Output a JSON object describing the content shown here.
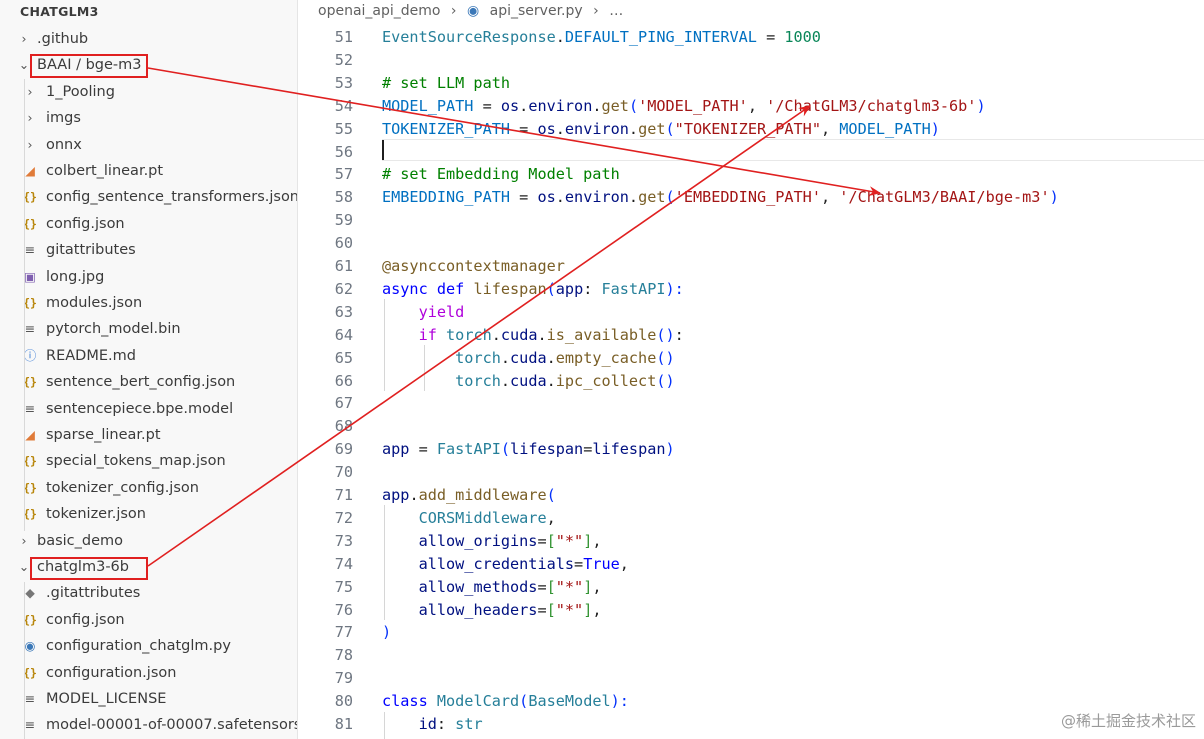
{
  "sidebar": {
    "title": "CHATGLM3",
    "items": [
      {
        "label": ".github",
        "icon": "chevron-right-icon",
        "glyph": "›",
        "cls": "chev",
        "name": "folder-github"
      },
      {
        "label": "BAAI / bge-m3",
        "icon": "chevron-down-icon",
        "glyph": "⌄",
        "cls": "chev",
        "name": "folder-baai-bge-m3"
      },
      {
        "label": "1_Pooling",
        "icon": "chevron-right-icon",
        "glyph": "›",
        "cls": "chev",
        "name": "folder-1-pooling"
      },
      {
        "label": "imgs",
        "icon": "chevron-right-icon",
        "glyph": "›",
        "cls": "chev",
        "name": "folder-imgs"
      },
      {
        "label": "onnx",
        "icon": "chevron-right-icon",
        "glyph": "›",
        "cls": "chev",
        "name": "folder-onnx"
      },
      {
        "label": "colbert_linear.pt",
        "icon": "rss-file-icon",
        "glyph": "◢",
        "cls": "ic-rss",
        "name": "file-colbert-linear"
      },
      {
        "label": "config_sentence_transformers.json",
        "icon": "json-file-icon",
        "glyph": "{}",
        "cls": "ic-json",
        "name": "file-config-sentence-transformers"
      },
      {
        "label": "config.json",
        "icon": "json-file-icon",
        "glyph": "{}",
        "cls": "ic-json",
        "name": "file-config-json"
      },
      {
        "label": "gitattributes",
        "icon": "lines-file-icon",
        "glyph": "≡",
        "cls": "ic-lines",
        "name": "file-gitattributes"
      },
      {
        "label": "long.jpg",
        "icon": "image-file-icon",
        "glyph": "▣",
        "cls": "ic-img",
        "name": "file-long-jpg"
      },
      {
        "label": "modules.json",
        "icon": "json-file-icon",
        "glyph": "{}",
        "cls": "ic-json",
        "name": "file-modules-json"
      },
      {
        "label": "pytorch_model.bin",
        "icon": "lines-file-icon",
        "glyph": "≡",
        "cls": "ic-lines",
        "name": "file-pytorch-model-bin"
      },
      {
        "label": "README.md",
        "icon": "info-file-icon",
        "glyph": "ⓘ",
        "cls": "ic-info",
        "name": "file-readme"
      },
      {
        "label": "sentence_bert_config.json",
        "icon": "json-file-icon",
        "glyph": "{}",
        "cls": "ic-json",
        "name": "file-sentence-bert-config"
      },
      {
        "label": "sentencepiece.bpe.model",
        "icon": "lines-file-icon",
        "glyph": "≡",
        "cls": "ic-lines",
        "name": "file-sentencepiece-model"
      },
      {
        "label": "sparse_linear.pt",
        "icon": "rss-file-icon",
        "glyph": "◢",
        "cls": "ic-rss",
        "name": "file-sparse-linear"
      },
      {
        "label": "special_tokens_map.json",
        "icon": "json-file-icon",
        "glyph": "{}",
        "cls": "ic-json",
        "name": "file-special-tokens-map"
      },
      {
        "label": "tokenizer_config.json",
        "icon": "json-file-icon",
        "glyph": "{}",
        "cls": "ic-json",
        "name": "file-tokenizer-config"
      },
      {
        "label": "tokenizer.json",
        "icon": "json-file-icon",
        "glyph": "{}",
        "cls": "ic-json",
        "name": "file-tokenizer-json"
      },
      {
        "label": "basic_demo",
        "icon": "chevron-right-icon",
        "glyph": "›",
        "cls": "chev",
        "name": "folder-basic-demo"
      },
      {
        "label": "chatglm3-6b",
        "icon": "chevron-down-icon",
        "glyph": "⌄",
        "cls": "chev",
        "name": "folder-chatglm3-6b"
      },
      {
        "label": ".gitattributes",
        "icon": "git-file-icon",
        "glyph": "◆",
        "cls": "ic-git",
        "name": "file-dot-gitattributes"
      },
      {
        "label": "config.json",
        "icon": "json-file-icon",
        "glyph": "{}",
        "cls": "ic-json",
        "name": "file-config-json-2"
      },
      {
        "label": "configuration_chatglm.py",
        "icon": "python-file-icon",
        "glyph": "◉",
        "cls": "ic-py",
        "name": "file-configuration-chatglm"
      },
      {
        "label": "configuration.json",
        "icon": "json-file-icon",
        "glyph": "{}",
        "cls": "ic-json",
        "name": "file-configuration-json"
      },
      {
        "label": "MODEL_LICENSE",
        "icon": "lines-file-icon",
        "glyph": "≡",
        "cls": "ic-lines",
        "name": "file-model-license"
      },
      {
        "label": "model-00001-of-00007.safetensors",
        "icon": "lines-file-icon",
        "glyph": "≡",
        "cls": "ic-lines",
        "name": "file-model-safetensors"
      }
    ]
  },
  "breadcrumb": {
    "folder": "openai_api_demo",
    "sep": "›",
    "file": "api_server.py",
    "more": "…"
  },
  "editor": {
    "lines": [
      {
        "n": "51",
        "tokens": [
          [
            "EventSourceResponse",
            "cls"
          ],
          [
            ".",
            "pl"
          ],
          [
            "DEFAULT_PING_INTERVAL",
            "cst"
          ],
          [
            " = ",
            "pl"
          ],
          [
            "1000",
            "num"
          ]
        ]
      },
      {
        "n": "52",
        "tokens": []
      },
      {
        "n": "53",
        "tokens": [
          [
            "# set LLM path",
            "com"
          ]
        ]
      },
      {
        "n": "54",
        "tokens": [
          [
            "MODEL_PATH",
            "cst"
          ],
          [
            " = ",
            "pl"
          ],
          [
            "os",
            "var"
          ],
          [
            ".",
            "pl"
          ],
          [
            "environ",
            "var"
          ],
          [
            ".",
            "pl"
          ],
          [
            "get",
            "fn"
          ],
          [
            "(",
            "br1"
          ],
          [
            "'MODEL_PATH'",
            "str"
          ],
          [
            ", ",
            "pl"
          ],
          [
            "'/ChatGLM3/chatglm3-6b'",
            "str"
          ],
          [
            ")",
            "br1"
          ]
        ]
      },
      {
        "n": "55",
        "tokens": [
          [
            "TOKENIZER_PATH",
            "cst"
          ],
          [
            " = ",
            "pl"
          ],
          [
            "os",
            "var"
          ],
          [
            ".",
            "pl"
          ],
          [
            "environ",
            "var"
          ],
          [
            ".",
            "pl"
          ],
          [
            "get",
            "fn"
          ],
          [
            "(",
            "br1"
          ],
          [
            "\"TOKENIZER_PATH\"",
            "str"
          ],
          [
            ", ",
            "pl"
          ],
          [
            "MODEL_PATH",
            "cst"
          ],
          [
            ")",
            "br1"
          ]
        ]
      },
      {
        "n": "56",
        "tokens": []
      },
      {
        "n": "57",
        "tokens": [
          [
            "# set Embedding Model path",
            "com"
          ]
        ]
      },
      {
        "n": "58",
        "tokens": [
          [
            "EMBEDDING_PATH",
            "cst"
          ],
          [
            " = ",
            "pl"
          ],
          [
            "os",
            "var"
          ],
          [
            ".",
            "pl"
          ],
          [
            "environ",
            "var"
          ],
          [
            ".",
            "pl"
          ],
          [
            "get",
            "fn"
          ],
          [
            "(",
            "br1"
          ],
          [
            "'EMBEDDING_PATH'",
            "str"
          ],
          [
            ", ",
            "pl"
          ],
          [
            "'/ChatGLM3/BAAI/bge-m3'",
            "str"
          ],
          [
            ")",
            "br1"
          ]
        ]
      },
      {
        "n": "59",
        "tokens": []
      },
      {
        "n": "60",
        "tokens": []
      },
      {
        "n": "61",
        "tokens": [
          [
            "@asynccontextmanager",
            "fn"
          ]
        ]
      },
      {
        "n": "62",
        "tokens": [
          [
            "async",
            "kw"
          ],
          [
            " ",
            "pl"
          ],
          [
            "def",
            "kw"
          ],
          [
            " ",
            "pl"
          ],
          [
            "lifespan",
            "fn"
          ],
          [
            "(",
            "br1"
          ],
          [
            "app",
            "var"
          ],
          [
            ": ",
            "pl"
          ],
          [
            "FastAPI",
            "cls"
          ],
          [
            "):",
            "br1"
          ]
        ]
      },
      {
        "n": "63",
        "tokens": [
          [
            "    ",
            "pl"
          ],
          [
            "yield",
            "ctl"
          ]
        ]
      },
      {
        "n": "64",
        "tokens": [
          [
            "    ",
            "pl"
          ],
          [
            "if",
            "ctl"
          ],
          [
            " ",
            "pl"
          ],
          [
            "torch",
            "cls"
          ],
          [
            ".",
            "pl"
          ],
          [
            "cuda",
            "var"
          ],
          [
            ".",
            "pl"
          ],
          [
            "is_available",
            "fn"
          ],
          [
            "()",
            "br1"
          ],
          [
            ":",
            "pl"
          ]
        ]
      },
      {
        "n": "65",
        "tokens": [
          [
            "        ",
            "pl"
          ],
          [
            "torch",
            "cls"
          ],
          [
            ".",
            "pl"
          ],
          [
            "cuda",
            "var"
          ],
          [
            ".",
            "pl"
          ],
          [
            "empty_cache",
            "fn"
          ],
          [
            "()",
            "br1"
          ]
        ]
      },
      {
        "n": "66",
        "tokens": [
          [
            "        ",
            "pl"
          ],
          [
            "torch",
            "cls"
          ],
          [
            ".",
            "pl"
          ],
          [
            "cuda",
            "var"
          ],
          [
            ".",
            "pl"
          ],
          [
            "ipc_collect",
            "fn"
          ],
          [
            "()",
            "br1"
          ]
        ]
      },
      {
        "n": "67",
        "tokens": []
      },
      {
        "n": "68",
        "tokens": []
      },
      {
        "n": "69",
        "tokens": [
          [
            "app",
            "var"
          ],
          [
            " = ",
            "pl"
          ],
          [
            "FastAPI",
            "cls"
          ],
          [
            "(",
            "br1"
          ],
          [
            "lifespan",
            "var"
          ],
          [
            "=",
            "pl"
          ],
          [
            "lifespan",
            "var"
          ],
          [
            ")",
            "br1"
          ]
        ]
      },
      {
        "n": "70",
        "tokens": []
      },
      {
        "n": "71",
        "tokens": [
          [
            "app",
            "var"
          ],
          [
            ".",
            "pl"
          ],
          [
            "add_middleware",
            "fn"
          ],
          [
            "(",
            "br1"
          ]
        ]
      },
      {
        "n": "72",
        "tokens": [
          [
            "    ",
            "pl"
          ],
          [
            "CORSMiddleware",
            "cls"
          ],
          [
            ",",
            "pl"
          ]
        ]
      },
      {
        "n": "73",
        "tokens": [
          [
            "    ",
            "pl"
          ],
          [
            "allow_origins",
            "var"
          ],
          [
            "=",
            "pl"
          ],
          [
            "[",
            "br2"
          ],
          [
            "\"*\"",
            "str"
          ],
          [
            "]",
            "br2"
          ],
          [
            ",",
            "pl"
          ]
        ]
      },
      {
        "n": "74",
        "tokens": [
          [
            "    ",
            "pl"
          ],
          [
            "allow_credentials",
            "var"
          ],
          [
            "=",
            "pl"
          ],
          [
            "True",
            "kw"
          ],
          [
            ",",
            "pl"
          ]
        ]
      },
      {
        "n": "75",
        "tokens": [
          [
            "    ",
            "pl"
          ],
          [
            "allow_methods",
            "var"
          ],
          [
            "=",
            "pl"
          ],
          [
            "[",
            "br2"
          ],
          [
            "\"*\"",
            "str"
          ],
          [
            "]",
            "br2"
          ],
          [
            ",",
            "pl"
          ]
        ]
      },
      {
        "n": "76",
        "tokens": [
          [
            "    ",
            "pl"
          ],
          [
            "allow_headers",
            "var"
          ],
          [
            "=",
            "pl"
          ],
          [
            "[",
            "br2"
          ],
          [
            "\"*\"",
            "str"
          ],
          [
            "]",
            "br2"
          ],
          [
            ",",
            "pl"
          ]
        ]
      },
      {
        "n": "77",
        "tokens": [
          [
            ")",
            "br1"
          ]
        ]
      },
      {
        "n": "78",
        "tokens": []
      },
      {
        "n": "79",
        "tokens": []
      },
      {
        "n": "80",
        "tokens": [
          [
            "class",
            "kw"
          ],
          [
            " ",
            "pl"
          ],
          [
            "ModelCard",
            "cls"
          ],
          [
            "(",
            "br1"
          ],
          [
            "BaseModel",
            "cls"
          ],
          [
            "):",
            "br1"
          ]
        ]
      },
      {
        "n": "81",
        "tokens": [
          [
            "    ",
            "pl"
          ],
          [
            "id",
            "var"
          ],
          [
            ": ",
            "pl"
          ],
          [
            "str",
            "cls"
          ]
        ]
      }
    ]
  },
  "watermark": "@稀土掘金技术社区",
  "colors": {
    "annotation": "#e02020",
    "sidebar_bg": "#f8f8f8",
    "editor_bg": "#ffffff"
  }
}
